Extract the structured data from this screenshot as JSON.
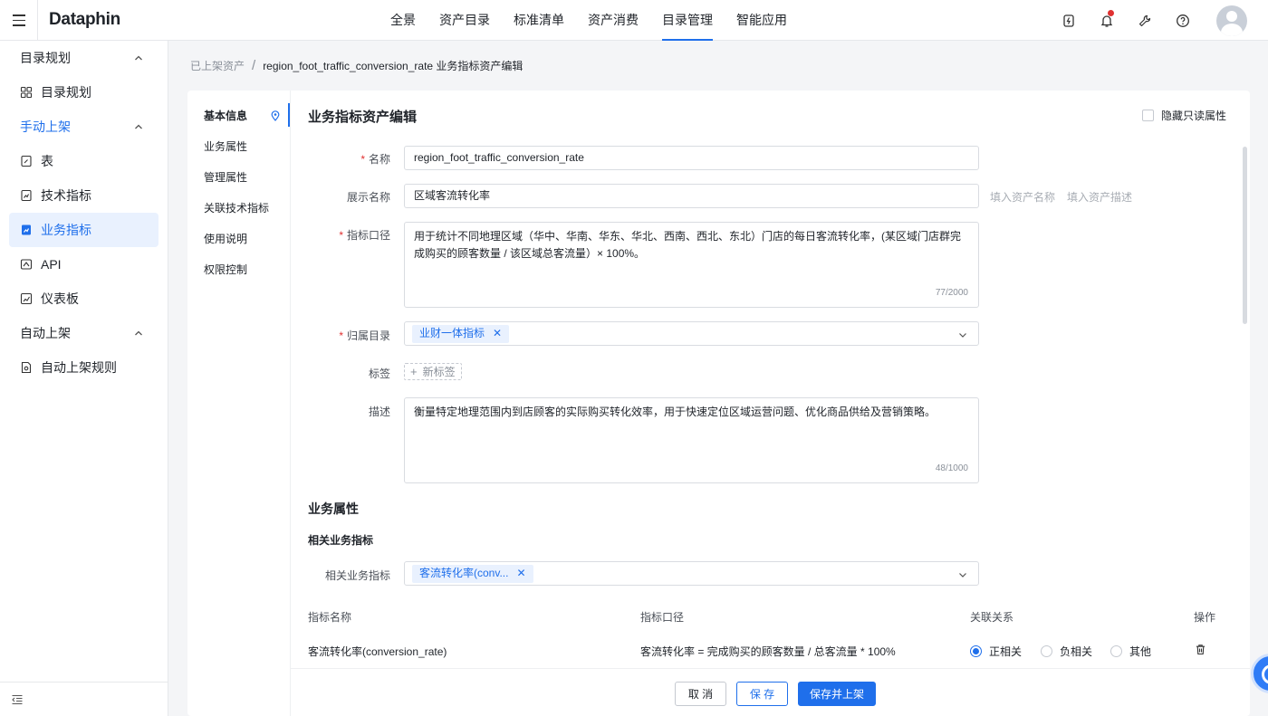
{
  "app": {
    "logo": "Dataphin"
  },
  "topnav": [
    {
      "label": "全景",
      "active": false
    },
    {
      "label": "资产目录",
      "active": false
    },
    {
      "label": "标准清单",
      "active": false
    },
    {
      "label": "资产消费",
      "active": false
    },
    {
      "label": "目录管理",
      "active": true
    },
    {
      "label": "智能应用",
      "active": false
    }
  ],
  "sidebar": {
    "group1": "目录规划",
    "item_catalog_plan": "目录规划",
    "group2": "手动上架",
    "item_table": "表",
    "item_tech_metric": "技术指标",
    "item_biz_metric": "业务指标",
    "item_api": "API",
    "item_dashboard": "仪表板",
    "group3": "自动上架",
    "item_auto_rule": "自动上架规则"
  },
  "breadcrumb": {
    "parent": "已上架资产",
    "current": "region_foot_traffic_conversion_rate 业务指标资产编辑"
  },
  "anchor": [
    "基本信息",
    "业务属性",
    "管理属性",
    "关联技术指标",
    "使用说明",
    "权限控制"
  ],
  "form": {
    "title": "业务指标资产编辑",
    "hide_readonly": "隐藏只读属性",
    "name_label": "名称",
    "name_value": "region_foot_traffic_conversion_rate",
    "display_label": "展示名称",
    "display_value": "区域客流转化率",
    "fill_name": "填入资产名称",
    "fill_desc": "填入资产描述",
    "caliber_label": "指标口径",
    "caliber_value": "用于统计不同地理区域（华中、华南、华东、华北、西南、西北、东北）门店的每日客流转化率，(某区域门店群完成购买的顾客数量 / 该区域总客流量）× 100%。",
    "caliber_count": "77/2000",
    "catalog_label": "归属目录",
    "catalog_tag": "业财一体指标",
    "tags_label": "标签",
    "new_tag": "新标签",
    "desc_label": "描述",
    "desc_value": "衡量特定地理范围内到店顾客的实际购买转化效率，用于快速定位区域运营问题、优化商品供给及营销策略。",
    "desc_count": "48/1000"
  },
  "biz": {
    "section": "业务属性",
    "subsection": "相关业务指标",
    "related_label": "相关业务指标",
    "related_tag": "客流转化率(conv...",
    "col_name": "指标名称",
    "col_caliber": "指标口径",
    "col_relation": "关联关系",
    "col_ops": "操作",
    "row_name": "客流转化率(conversion_rate)",
    "row_caliber": "客流转化率 = 完成购买的顾客数量 / 总客流量 * 100%",
    "rel_pos": "正相关",
    "rel_neg": "负相关",
    "rel_other": "其他"
  },
  "footer": {
    "cancel": "取 消",
    "save": "保 存",
    "save_publish": "保存并上架"
  },
  "colors": {
    "accent": "#1f6feb",
    "required": "#e03131"
  }
}
